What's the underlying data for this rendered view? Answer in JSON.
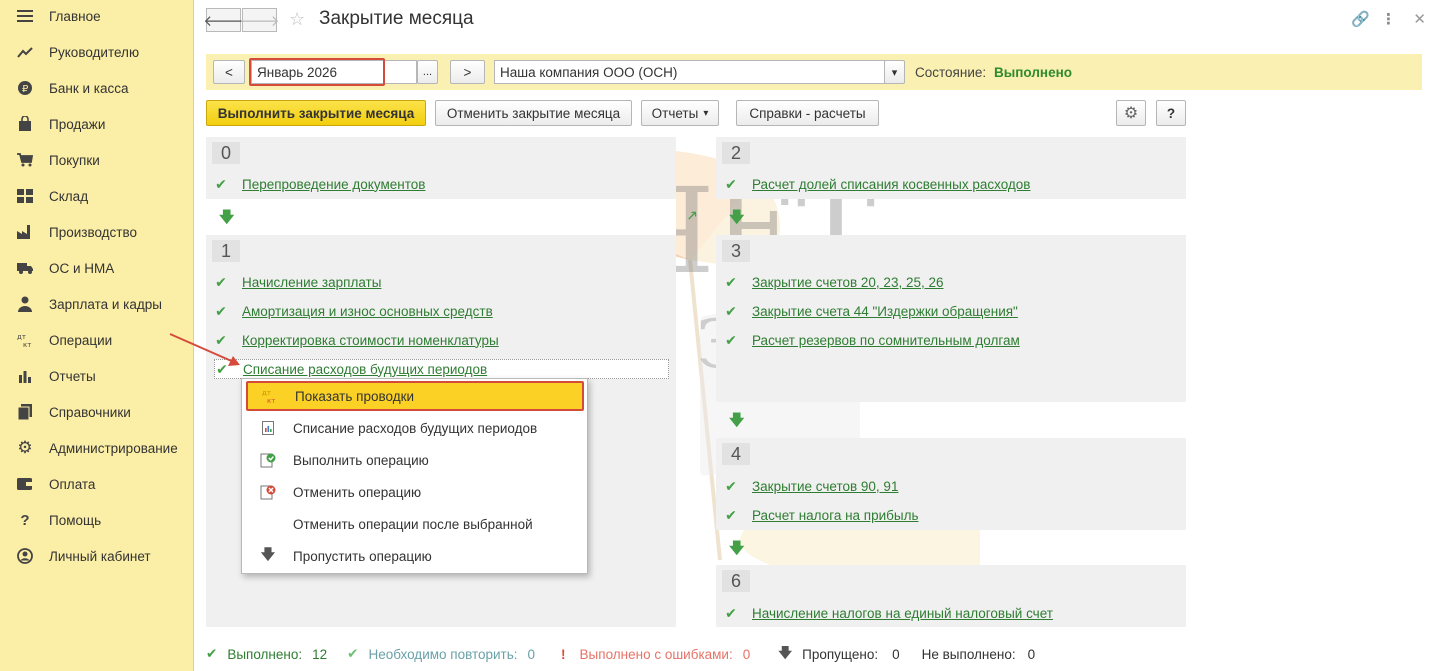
{
  "sidebar": {
    "items": [
      {
        "label": "Главное",
        "icon": "menu-icon"
      },
      {
        "label": "Руководителю",
        "icon": "trend-icon"
      },
      {
        "label": "Банк и касса",
        "icon": "ruble-icon"
      },
      {
        "label": "Продажи",
        "icon": "bag-icon"
      },
      {
        "label": "Покупки",
        "icon": "cart-icon"
      },
      {
        "label": "Склад",
        "icon": "warehouse-icon"
      },
      {
        "label": "Производство",
        "icon": "factory-icon"
      },
      {
        "label": "ОС и НМА",
        "icon": "truck-icon"
      },
      {
        "label": "Зарплата и кадры",
        "icon": "person-icon"
      },
      {
        "label": "Операции",
        "icon": "dt-kt-icon"
      },
      {
        "label": "Отчеты",
        "icon": "bar-chart-icon"
      },
      {
        "label": "Справочники",
        "icon": "books-icon"
      },
      {
        "label": "Администрирование",
        "icon": "gear-icon"
      },
      {
        "label": "Оплата",
        "icon": "wallet-icon"
      },
      {
        "label": "Помощь",
        "icon": "question-icon"
      },
      {
        "label": "Личный кабинет",
        "icon": "account-icon"
      }
    ]
  },
  "header": {
    "back": "🡐",
    "forward": "🡒",
    "star": "☆",
    "title": "Закрытие месяца",
    "link_icon": "🔗",
    "more_icon": "⋮",
    "close_icon": "✕"
  },
  "params": {
    "prev": "<",
    "period": "Январь 2026",
    "ellipsis": "...",
    "next": ">",
    "organization": "Наша компания ООО (ОСН)",
    "dropdown": "▾",
    "state_label": "Состояние:",
    "state_value": "Выполнено"
  },
  "toolbar": {
    "run": "Выполнить закрытие месяца",
    "cancel": "Отменить закрытие месяца",
    "reports": "Отчеты",
    "reports_arrow": "▾",
    "certificates": "Справки - расчеты",
    "settings_icon": "⚙",
    "help": "?"
  },
  "stages": {
    "s0": {
      "num": "0",
      "steps": [
        "Перепроведение документов"
      ]
    },
    "s1": {
      "num": "1",
      "steps": [
        "Начисление зарплаты",
        "Амортизация и износ основных средств",
        "Корректировка стоимости номенклатуры",
        "Списание расходов будущих периодов"
      ]
    },
    "s2": {
      "num": "2",
      "steps": [
        "Расчет долей списания косвенных расходов"
      ]
    },
    "s3": {
      "num": "3",
      "steps": [
        "Закрытие счетов 20, 23, 25, 26",
        "Закрытие счета 44 \"Издержки обращения\"",
        "Расчет резервов по сомнительным долгам"
      ]
    },
    "s4": {
      "num": "4",
      "steps": [
        "Закрытие счетов 90, 91",
        "Расчет налога на прибыль"
      ]
    },
    "s6": {
      "num": "6",
      "steps": [
        "Начисление налогов на единый налоговый счет"
      ]
    }
  },
  "marks": {
    "check": "✔",
    "down": "🡇",
    "diag": "🡕"
  },
  "context_menu": {
    "items": [
      {
        "label": "Показать проводки",
        "icon": "dt-kt-icon"
      },
      {
        "label": "Списание расходов будущих периодов",
        "icon": "document-icon"
      },
      {
        "label": "Выполнить операцию",
        "icon": "execute-icon"
      },
      {
        "label": "Отменить операцию",
        "icon": "cancel-operation-icon"
      },
      {
        "label": "Отменить операции после выбранной",
        "icon": ""
      },
      {
        "label": "Пропустить операцию",
        "icon": "skip-arrow-icon"
      }
    ],
    "dtkt": "ДТ КТ"
  },
  "footer": {
    "done_label": "Выполнено:",
    "done_count": "12",
    "repeat_label": "Необходимо повторить:",
    "repeat_count": "0",
    "errors_label": "Выполнено с ошибками:",
    "errors_count": "0",
    "skipped_label": "Пропущено:",
    "skipped_count": "0",
    "notdone_label": "Не выполнено:",
    "notdone_count": "0",
    "error_mark": "!",
    "skip_mark": "🡇"
  },
  "watermark": {
    "line1": "УЧЕТ",
    "line2": "БЕЗ ЗАБОТ"
  },
  "colors": {
    "sidebar_bg": "#fbeea6",
    "accent_yellow": "#fbd125",
    "link_green": "#2e7d32",
    "check_green": "#43a047",
    "highlight_red": "#d54b3b"
  }
}
